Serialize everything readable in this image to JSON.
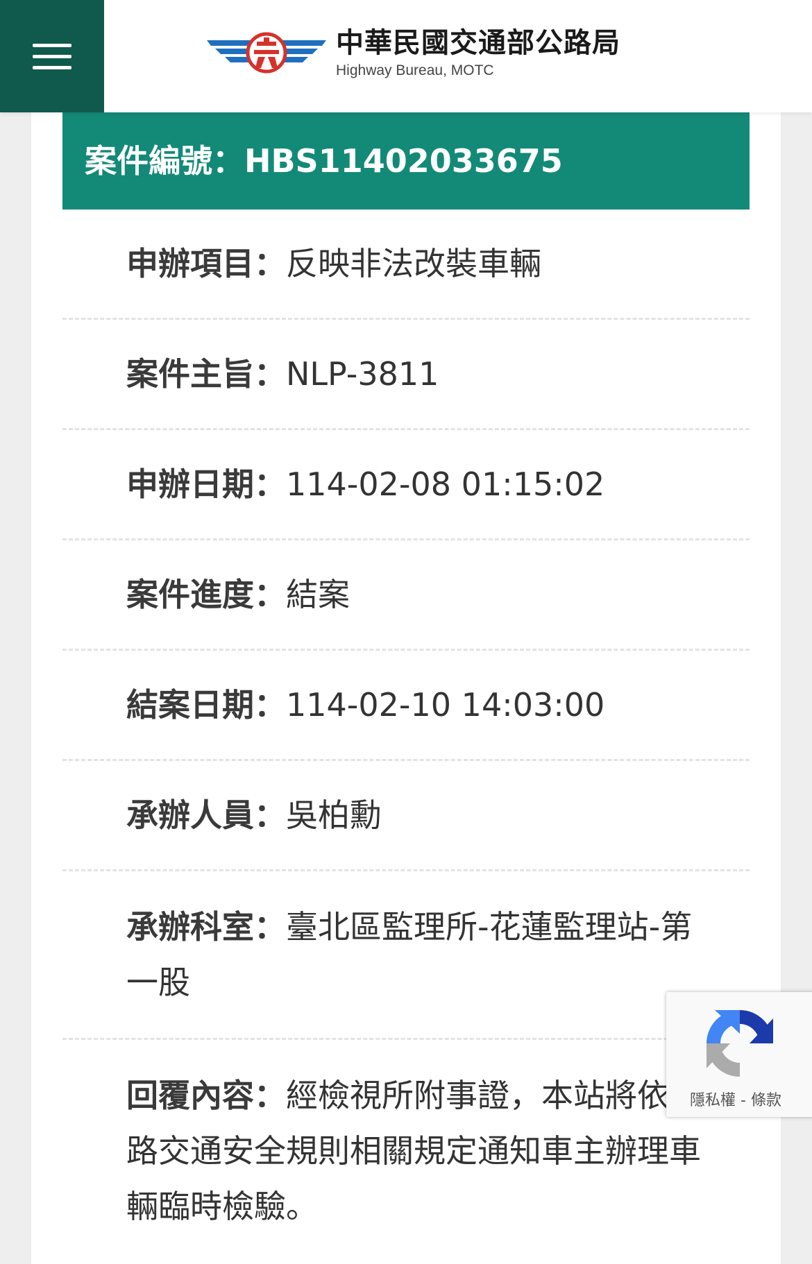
{
  "header": {
    "title_zh": "中華民國交通部公路局",
    "title_en": "Highway Bureau, MOTC",
    "logo_icon": "highway-bureau-winged-emblem-icon",
    "menu_icon": "hamburger-menu-icon",
    "colors": {
      "menu_bg": "#0f5a4c",
      "logo_blue": "#1f6fc0",
      "logo_red": "#d6312b"
    }
  },
  "case": {
    "header_label": "案件編號：",
    "number": "HBS11402033675",
    "header_color": "#138a77",
    "fields": [
      {
        "label": "申辦項目：",
        "value": "反映非法改裝車輛"
      },
      {
        "label": "案件主旨：",
        "value": "NLP-3811"
      },
      {
        "label": "申辦日期：",
        "value": "114-02-08 01:15:02"
      },
      {
        "label": "案件進度：",
        "value": "結案"
      },
      {
        "label": "結案日期：",
        "value": "114-02-10 14:03:00"
      },
      {
        "label": "承辦人員：",
        "value": "吳柏勳"
      },
      {
        "label": "承辦科室：",
        "value": "臺北區監理所-花蓮監理站-第一股"
      },
      {
        "label": "回覆內容：",
        "value": "經檢視所附事證，本站將依道路交通安全規則相關規定通知車主辦理車輛臨時檢驗。"
      }
    ]
  },
  "recaptcha": {
    "icon": "recaptcha-icon",
    "privacy": "隱私權",
    "separator": " - ",
    "terms": "條款"
  }
}
